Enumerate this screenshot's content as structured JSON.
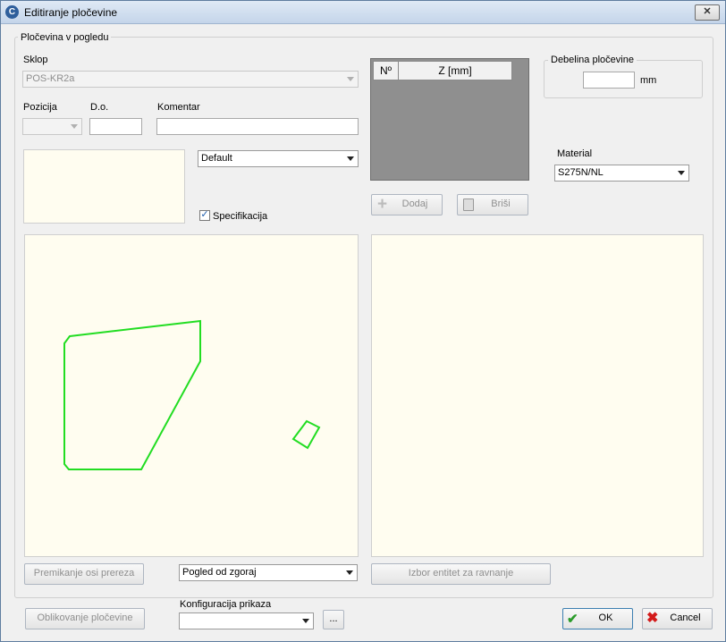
{
  "window": {
    "title": "Editiranje pločevine",
    "close_symbol": "✕"
  },
  "group": {
    "legend": "Pločevina v pogledu"
  },
  "sklop": {
    "label": "Sklop",
    "value": "POS-KR2a"
  },
  "pozicija": {
    "label": "Pozicija"
  },
  "do": {
    "label": "D.o."
  },
  "komentar": {
    "label": "Komentar"
  },
  "style_select": {
    "value": "Default"
  },
  "specifikacija": {
    "label": "Specifikacija",
    "checked": true
  },
  "grid": {
    "col_no": "Nº",
    "col_z": "Z [mm]"
  },
  "buttons": {
    "dodaj": "Dodaj",
    "brisi": "Briši",
    "premikanje": "Premikanje osi prereza",
    "izbor": "Izbor entitet za ravnanje",
    "oblikovanje": "Oblikovanje pločevine",
    "ok": "OK",
    "cancel": "Cancel",
    "more": "..."
  },
  "thickness": {
    "legend": "Debelina pločevine",
    "unit": "mm"
  },
  "material": {
    "label": "Material",
    "value": "S275N/NL"
  },
  "view_select": {
    "value": "Pogled od zgoraj"
  },
  "config": {
    "label": "Konfiguracija prikaza"
  },
  "colors": {
    "shape": "#22dd22",
    "panel_bg": "#fffdf0",
    "grid_bg": "#8f8f8f"
  }
}
